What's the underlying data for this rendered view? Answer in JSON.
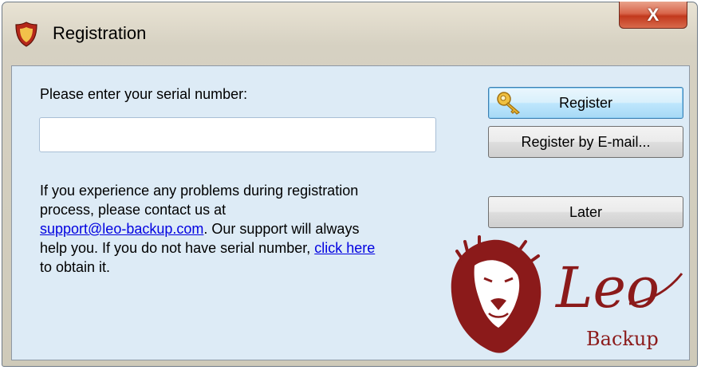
{
  "window": {
    "title": "Registration",
    "close_glyph": "X"
  },
  "form": {
    "prompt": "Please enter your serial number:",
    "serial_value": "",
    "info": {
      "line1": "If you experience any problems during registration",
      "line2": "process, please contact us at",
      "email_link": "support@leo-backup.com",
      "line3_after_email": ". Our support will always",
      "line4": "help you. If you do not have serial number, ",
      "click_here": "click here",
      "line5": "to obtain it."
    }
  },
  "buttons": {
    "register": "Register",
    "register_by_email": "Register by E-mail...",
    "later": "Later"
  },
  "logo": {
    "name": "Leo",
    "subtitle": "Backup",
    "color": "#8b1a1a"
  },
  "icons": {
    "app": "shield-icon",
    "register": "key-icon",
    "close": "close-icon"
  }
}
